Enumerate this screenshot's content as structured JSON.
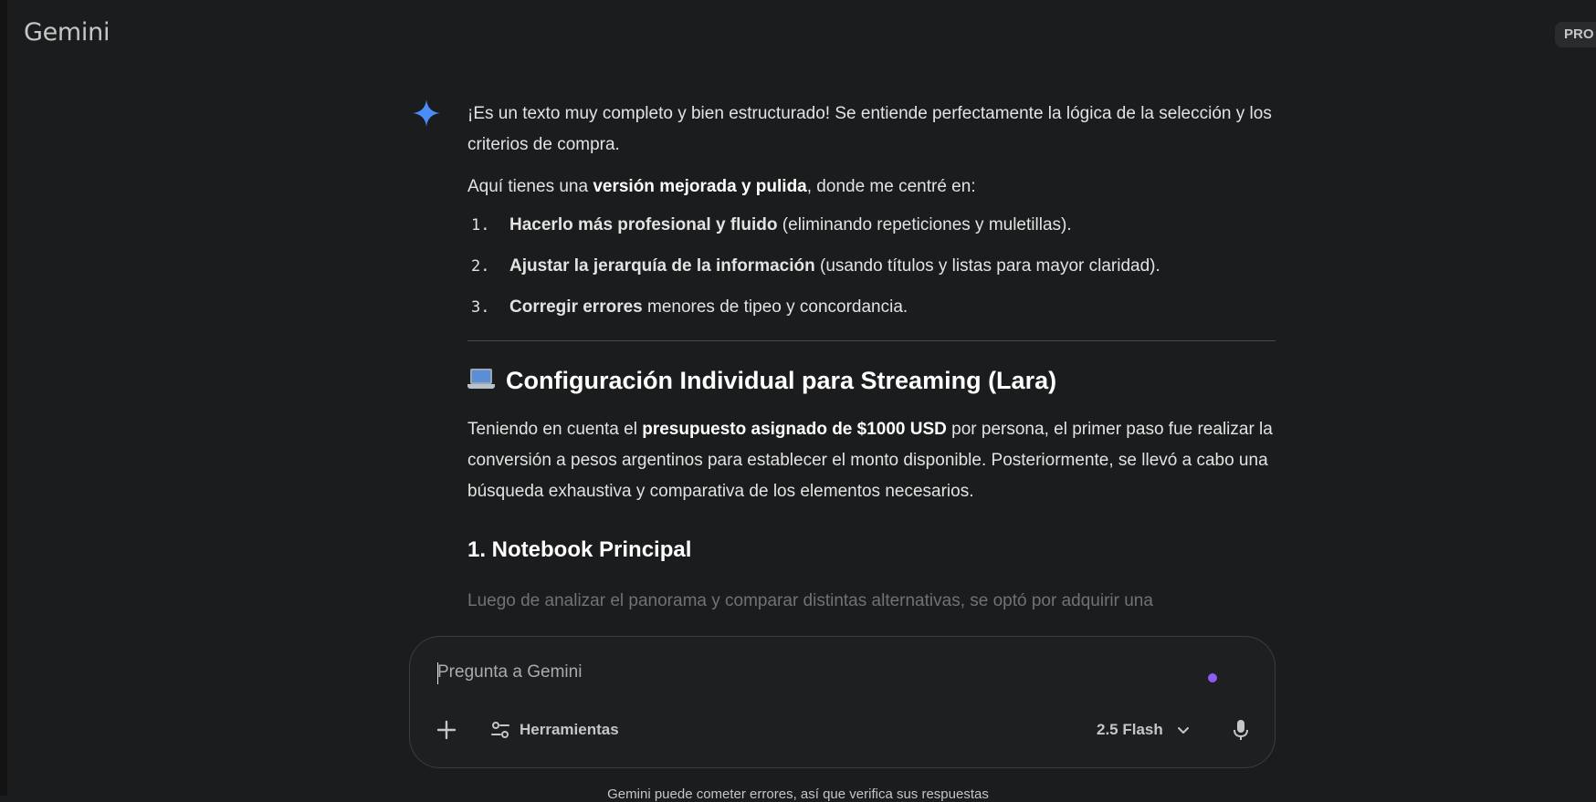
{
  "header": {
    "title": "Gemini",
    "plan_badge": "PRO"
  },
  "response": {
    "intro": "¡Es un texto muy completo y bien estructurado! Se entiende perfectamente la lógica de la selección y los criterios de compra.",
    "lead_prefix": "Aquí tienes una ",
    "lead_bold": "versión mejorada y pulida",
    "lead_suffix": ", donde me centré en:",
    "list": [
      {
        "num": "1.",
        "bold": "Hacerlo más profesional y fluido",
        "rest": " (eliminando repeticiones y muletillas)."
      },
      {
        "num": "2.",
        "bold": "Ajustar la jerarquía de la información",
        "rest": " (usando títulos y listas para mayor claridad)."
      },
      {
        "num": "3.",
        "bold": "Corregir errores",
        "rest": " menores de tipeo y concordancia."
      }
    ],
    "section_heading": "Configuración Individual para Streaming (Lara)",
    "section_body_prefix": "Teniendo en cuenta el ",
    "section_body_bold": "presupuesto asignado de $1000 USD",
    "section_body_suffix": " por persona, el primer paso fue realizar la conversión a pesos argentinos para establecer el monto disponible. Posteriormente, se llevó a cabo una búsqueda exhaustiva y comparativa de los elementos necesarios.",
    "subheading": "1. Notebook Principal",
    "faded_line": "Luego de analizar el panorama y comparar distintas alternativas, se optó por adquirir una"
  },
  "composer": {
    "placeholder": "Pregunta a Gemini",
    "tools_label": "Herramientas",
    "model_label": "2.5 Flash"
  },
  "footer": {
    "disclaimer": "Gemini puede cometer errores, así que verifica sus respuestas"
  },
  "colors": {
    "background": "#1b1c1d",
    "accent_spark": "#4b8df8",
    "dot": "#8b5cf6"
  },
  "icons": [
    "gemini-spark-icon",
    "laptop-emoji-icon",
    "plus-icon",
    "tools-icon",
    "chevron-down-icon",
    "mic-icon"
  ]
}
